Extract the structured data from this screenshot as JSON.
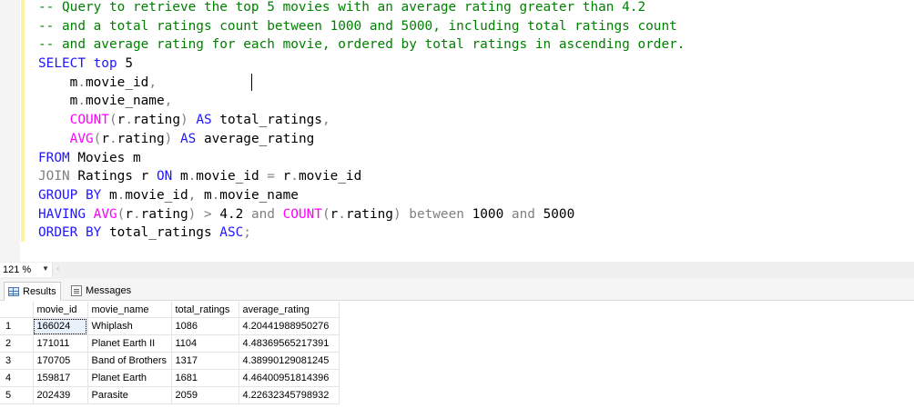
{
  "editor": {
    "lines": [
      [
        {
          "t": "-- Query to retrieve the top 5 movies with an average rating greater than 4.2",
          "c": "c"
        }
      ],
      [
        {
          "t": "-- and a total ratings count between 1000 and 5000, including total ratings count",
          "c": "c"
        }
      ],
      [
        {
          "t": "-- and average rating for each movie, ordered by total ratings in ascending order.",
          "c": "c"
        }
      ],
      [
        {
          "t": "SELECT top ",
          "c": "k"
        },
        {
          "t": "5",
          "c": "t"
        }
      ],
      [
        {
          "t": "    m",
          "c": "t"
        },
        {
          "t": ".",
          "c": "g"
        },
        {
          "t": "movie_id",
          "c": "t"
        },
        {
          "t": ",",
          "c": "g"
        }
      ],
      [
        {
          "t": "    m",
          "c": "t"
        },
        {
          "t": ".",
          "c": "g"
        },
        {
          "t": "movie_name",
          "c": "t"
        },
        {
          "t": ",",
          "c": "g"
        }
      ],
      [
        {
          "t": "    ",
          "c": "t"
        },
        {
          "t": "COUNT",
          "c": "f"
        },
        {
          "t": "(",
          "c": "g"
        },
        {
          "t": "r",
          "c": "t"
        },
        {
          "t": ".",
          "c": "g"
        },
        {
          "t": "rating",
          "c": "t"
        },
        {
          "t": ") ",
          "c": "g"
        },
        {
          "t": "AS",
          "c": "k"
        },
        {
          "t": " total_ratings",
          "c": "t"
        },
        {
          "t": ",",
          "c": "g"
        }
      ],
      [
        {
          "t": "    ",
          "c": "t"
        },
        {
          "t": "AVG",
          "c": "f"
        },
        {
          "t": "(",
          "c": "g"
        },
        {
          "t": "r",
          "c": "t"
        },
        {
          "t": ".",
          "c": "g"
        },
        {
          "t": "rating",
          "c": "t"
        },
        {
          "t": ") ",
          "c": "g"
        },
        {
          "t": "AS",
          "c": "k"
        },
        {
          "t": " average_rating",
          "c": "t"
        }
      ],
      [
        {
          "t": "FROM",
          "c": "k"
        },
        {
          "t": " Movies m",
          "c": "t"
        }
      ],
      [
        {
          "t": "JOIN",
          "c": "g"
        },
        {
          "t": " Ratings r ",
          "c": "t"
        },
        {
          "t": "ON",
          "c": "k"
        },
        {
          "t": " m",
          "c": "t"
        },
        {
          "t": ".",
          "c": "g"
        },
        {
          "t": "movie_id ",
          "c": "t"
        },
        {
          "t": "=",
          "c": "g"
        },
        {
          "t": " r",
          "c": "t"
        },
        {
          "t": ".",
          "c": "g"
        },
        {
          "t": "movie_id",
          "c": "t"
        }
      ],
      [
        {
          "t": "GROUP BY",
          "c": "k"
        },
        {
          "t": " m",
          "c": "t"
        },
        {
          "t": ".",
          "c": "g"
        },
        {
          "t": "movie_id",
          "c": "t"
        },
        {
          "t": ",",
          "c": "g"
        },
        {
          "t": " m",
          "c": "t"
        },
        {
          "t": ".",
          "c": "g"
        },
        {
          "t": "movie_name",
          "c": "t"
        }
      ],
      [
        {
          "t": "HAVING ",
          "c": "k"
        },
        {
          "t": "AVG",
          "c": "f"
        },
        {
          "t": "(",
          "c": "g"
        },
        {
          "t": "r",
          "c": "t"
        },
        {
          "t": ".",
          "c": "g"
        },
        {
          "t": "rating",
          "c": "t"
        },
        {
          "t": ") > ",
          "c": "g"
        },
        {
          "t": "4.2 ",
          "c": "t"
        },
        {
          "t": "and ",
          "c": "g"
        },
        {
          "t": "COUNT",
          "c": "f"
        },
        {
          "t": "(",
          "c": "g"
        },
        {
          "t": "r",
          "c": "t"
        },
        {
          "t": ".",
          "c": "g"
        },
        {
          "t": "rating",
          "c": "t"
        },
        {
          "t": ") ",
          "c": "g"
        },
        {
          "t": "between ",
          "c": "g"
        },
        {
          "t": "1000 ",
          "c": "t"
        },
        {
          "t": "and ",
          "c": "g"
        },
        {
          "t": "5000",
          "c": "t"
        }
      ],
      [
        {
          "t": "ORDER BY",
          "c": "k"
        },
        {
          "t": " total_ratings ",
          "c": "t"
        },
        {
          "t": "ASC",
          "c": "k"
        },
        {
          "t": ";",
          "c": "g"
        }
      ]
    ]
  },
  "zoom": {
    "value": "121 %"
  },
  "tabs": {
    "results": "Results",
    "messages": "Messages"
  },
  "grid": {
    "columns": [
      "movie_id",
      "movie_name",
      "total_ratings",
      "average_rating"
    ],
    "rows": [
      {
        "n": "1",
        "cells": [
          "166024",
          "Whiplash",
          "1086",
          "4.20441988950276"
        ]
      },
      {
        "n": "2",
        "cells": [
          "171011",
          "Planet Earth II",
          "1104",
          "4.48369565217391"
        ]
      },
      {
        "n": "3",
        "cells": [
          "170705",
          "Band of Brothers",
          "1317",
          "4.38990129081245"
        ]
      },
      {
        "n": "4",
        "cells": [
          "159817",
          "Planet Earth",
          "1681",
          "4.46400951814396"
        ]
      },
      {
        "n": "5",
        "cells": [
          "202439",
          "Parasite",
          "2059",
          "4.22632345798932"
        ]
      }
    ]
  },
  "colors": {
    "keyword": "#1f16ff",
    "function": "#ff00ff",
    "operator": "#808080",
    "comment": "#008000",
    "changebar": "#fff2a8"
  }
}
